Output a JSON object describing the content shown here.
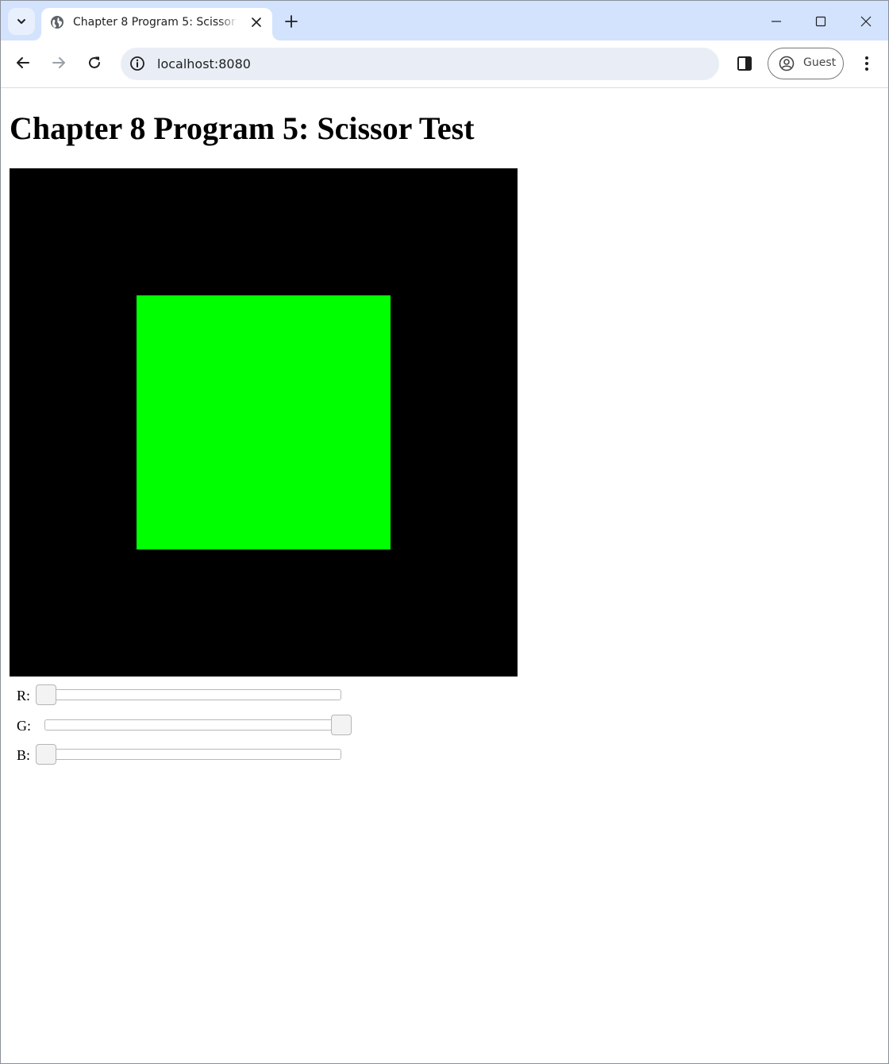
{
  "browser": {
    "tab": {
      "title": "Chapter 8 Program 5: Scissor Test",
      "favicon": "globe-icon"
    },
    "address_bar": {
      "url": "localhost:8080"
    },
    "profile": {
      "label": "Guest"
    }
  },
  "page": {
    "heading": "Chapter 8 Program 5: Scissor Test",
    "canvas": {
      "clear_color": "#000000",
      "scissor_fill_color": "#00ff00"
    },
    "sliders": [
      {
        "label": "R:",
        "value_fraction": 0.0
      },
      {
        "label": "G:",
        "value_fraction": 1.0
      },
      {
        "label": "B:",
        "value_fraction": 0.0
      }
    ]
  }
}
